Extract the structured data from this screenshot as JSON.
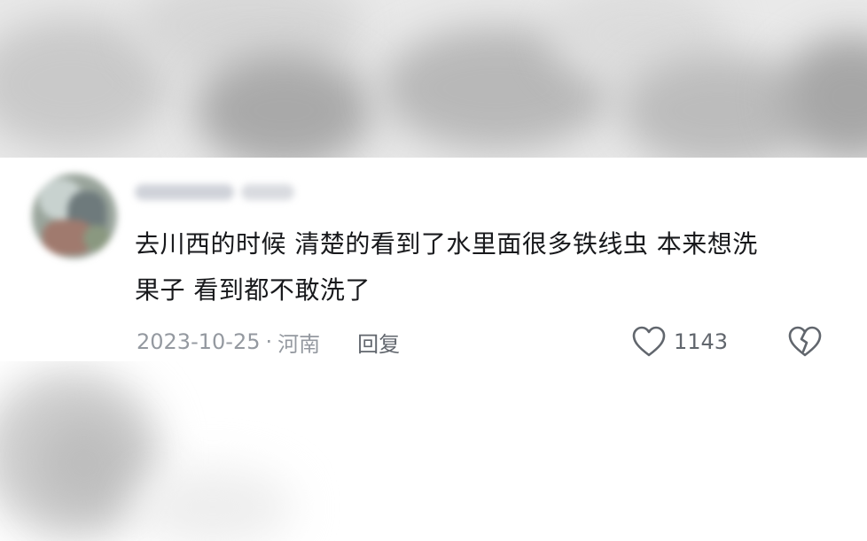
{
  "comment": {
    "text_line1": "去川西的时候 清楚的看到了水里面很多铁线虫 本来想洗",
    "text_line2": "果子 看到都不敢洗了",
    "date": "2023-10-25",
    "separator": "·",
    "location": "河南",
    "reply_label": "回复",
    "like_count": "1143"
  },
  "icons": {
    "like": "heart-outline-icon",
    "dislike": "broken-heart-icon"
  },
  "colors": {
    "text_primary": "#18191c",
    "text_secondary": "#9499a0",
    "icon": "#61666d"
  }
}
